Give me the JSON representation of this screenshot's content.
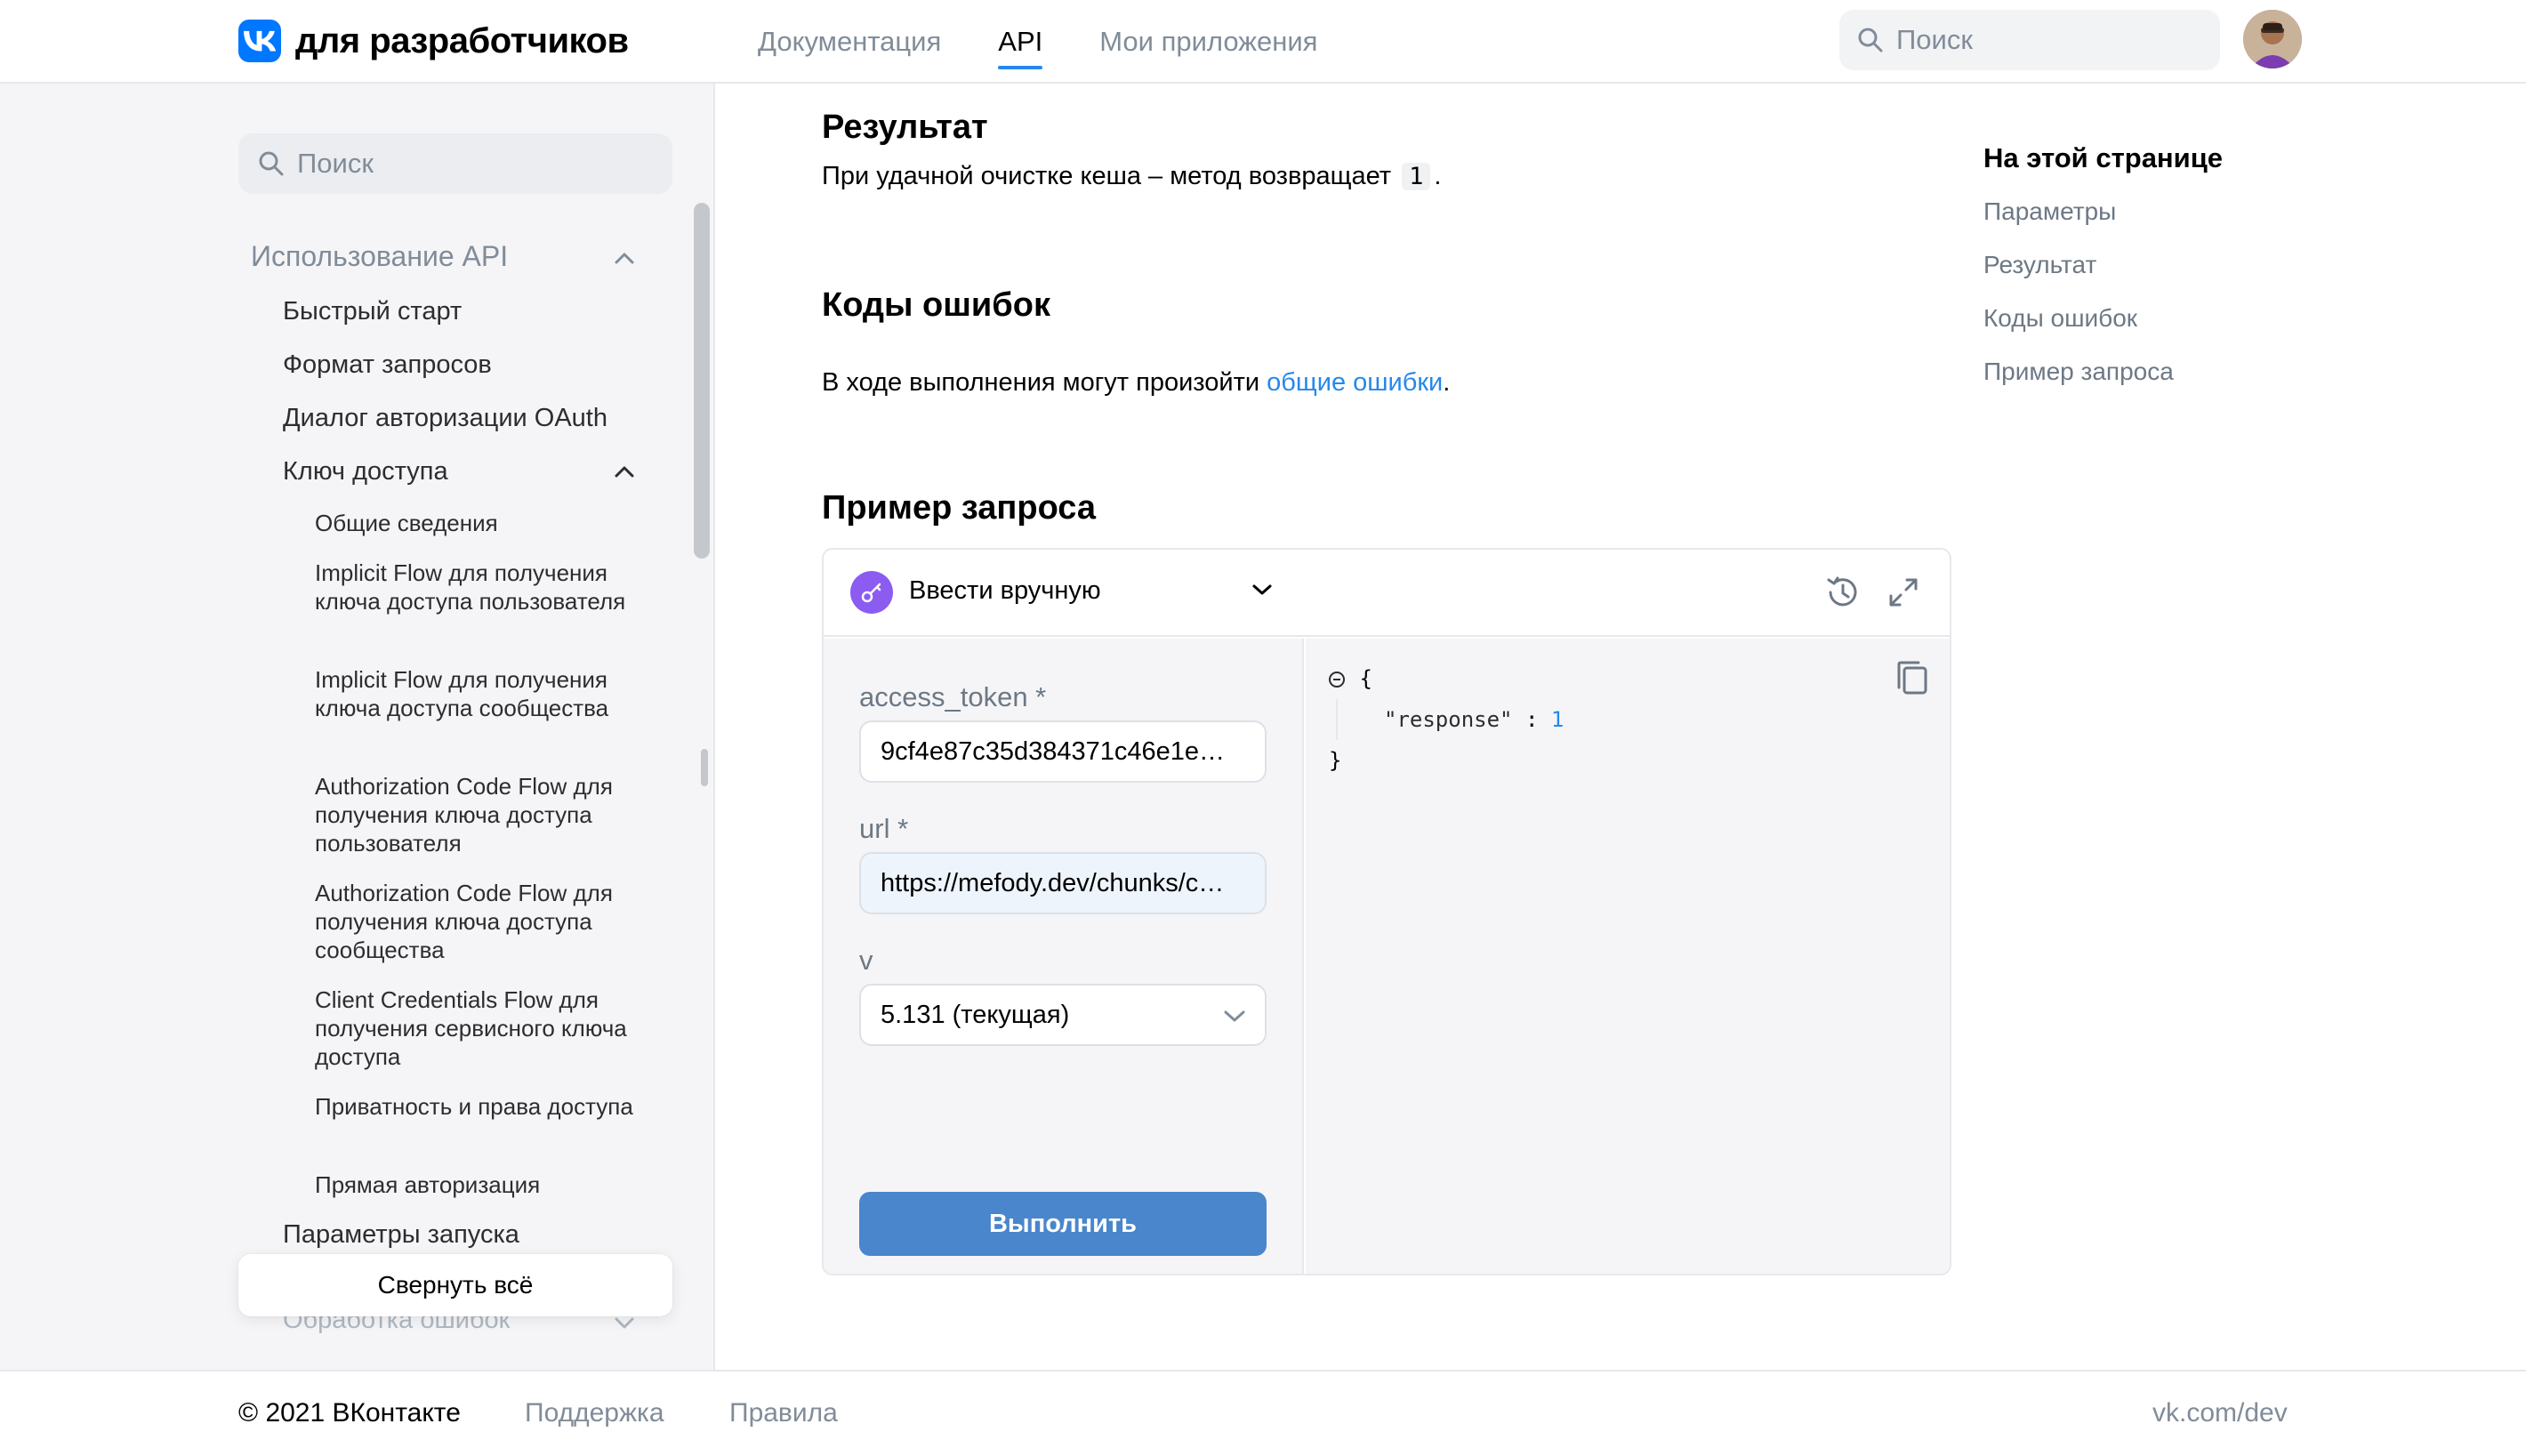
{
  "header": {
    "logo_text": "для разработчиков",
    "nav": [
      {
        "label": "Документация",
        "active": false
      },
      {
        "label": "API",
        "active": true
      },
      {
        "label": "Мои приложения",
        "active": false
      }
    ],
    "search_placeholder": "Поиск"
  },
  "sidebar": {
    "search_placeholder": "Поиск",
    "items": [
      {
        "label": "Использование API",
        "level": 0,
        "expanded": true
      },
      {
        "label": "Быстрый старт",
        "level": 1
      },
      {
        "label": "Формат запросов",
        "level": 1
      },
      {
        "label": "Диалог авторизации OAuth",
        "level": 1
      },
      {
        "label": "Ключ доступа",
        "level": 1,
        "expanded": true
      },
      {
        "label": "Общие сведения",
        "level": 2
      },
      {
        "label": "Implicit Flow для получения ключа доступа пользователя",
        "level": 2
      },
      {
        "label": "Implicit Flow для получения ключа доступа сообщества",
        "level": 2
      },
      {
        "label": "Authorization Code Flow для получения ключа доступа пользователя",
        "level": 2
      },
      {
        "label": "Authorization Code Flow для получения ключа доступа сообщества",
        "level": 2
      },
      {
        "label": "Client Credentials Flow для получения сервисного ключа доступа",
        "level": 2
      },
      {
        "label": "Приватность и права доступа",
        "level": 2
      },
      {
        "label": "Прямая авторизация",
        "level": 2
      },
      {
        "label": "Параметры запуска",
        "level": 1
      },
      {
        "label": "Обработка ошибок",
        "level": 1
      }
    ],
    "collapse_all_label": "Свернуть всё"
  },
  "content": {
    "result_heading": "Результат",
    "result_text_before": "При удачной очистке кеша – метод возвращает",
    "result_value": "1",
    "result_text_after": ".",
    "errors_heading": "Коды ошибок",
    "errors_text_before": "В ходе выполнения могут произойти",
    "errors_link": "общие ошибки",
    "errors_text_after": ".",
    "example_heading": "Пример запроса"
  },
  "console": {
    "method_label": "Ввести вручную",
    "fields": [
      {
        "label": "access_token *",
        "value": "9cf4e87c35d384371c46e1e…"
      },
      {
        "label": "url *",
        "value": "https://mefody.dev/chunks/c…"
      },
      {
        "label": "v",
        "value": "5.131 (текущая)"
      }
    ],
    "run_label": "Выполнить",
    "response": {
      "open": "{",
      "key": "\"response\"",
      "colon": ":",
      "value": "1",
      "close": "}"
    }
  },
  "toc": {
    "title": "На этой странице",
    "items": [
      "Параметры",
      "Результат",
      "Коды ошибок",
      "Пример запроса"
    ]
  },
  "footer": {
    "copyright": "© 2021 ВКонтакте",
    "links": [
      "Поддержка",
      "Правила"
    ],
    "site": "vk.com/dev"
  },
  "colors": {
    "accent": "#2688eb",
    "button": "#4986cc",
    "method_icon": "#8c5cf0",
    "brand": "#0077ff"
  }
}
